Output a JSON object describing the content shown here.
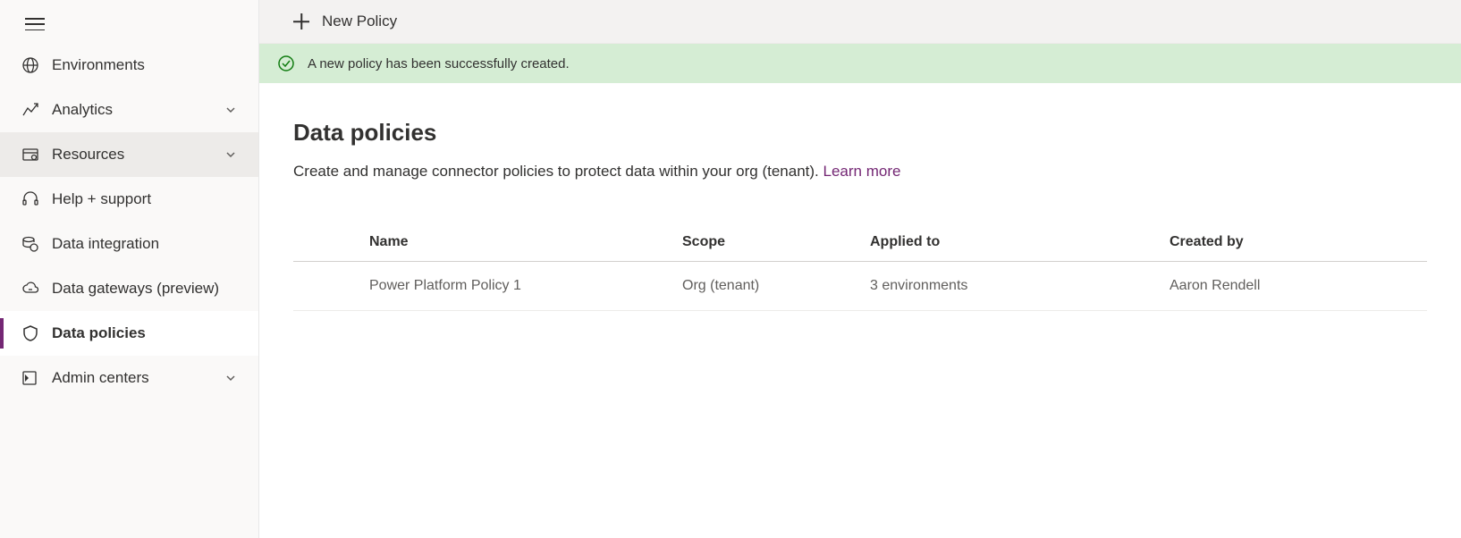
{
  "sidebar": {
    "items": [
      {
        "label": "Environments"
      },
      {
        "label": "Analytics"
      },
      {
        "label": "Resources"
      },
      {
        "label": "Help + support"
      },
      {
        "label": "Data integration"
      },
      {
        "label": "Data gateways (preview)"
      },
      {
        "label": "Data policies"
      },
      {
        "label": "Admin centers"
      }
    ]
  },
  "toolbar": {
    "new_policy_label": "New Policy"
  },
  "banner": {
    "message": "A new policy has been successfully created."
  },
  "page": {
    "title": "Data policies",
    "description": "Create and manage connector policies to protect data within your org (tenant). ",
    "learn_more": "Learn more"
  },
  "table": {
    "headers": {
      "name": "Name",
      "scope": "Scope",
      "applied_to": "Applied to",
      "created_by": "Created by"
    },
    "rows": [
      {
        "name": "Power Platform Policy 1",
        "scope": "Org (tenant)",
        "applied_to": "3 environments",
        "created_by": "Aaron Rendell"
      }
    ]
  }
}
